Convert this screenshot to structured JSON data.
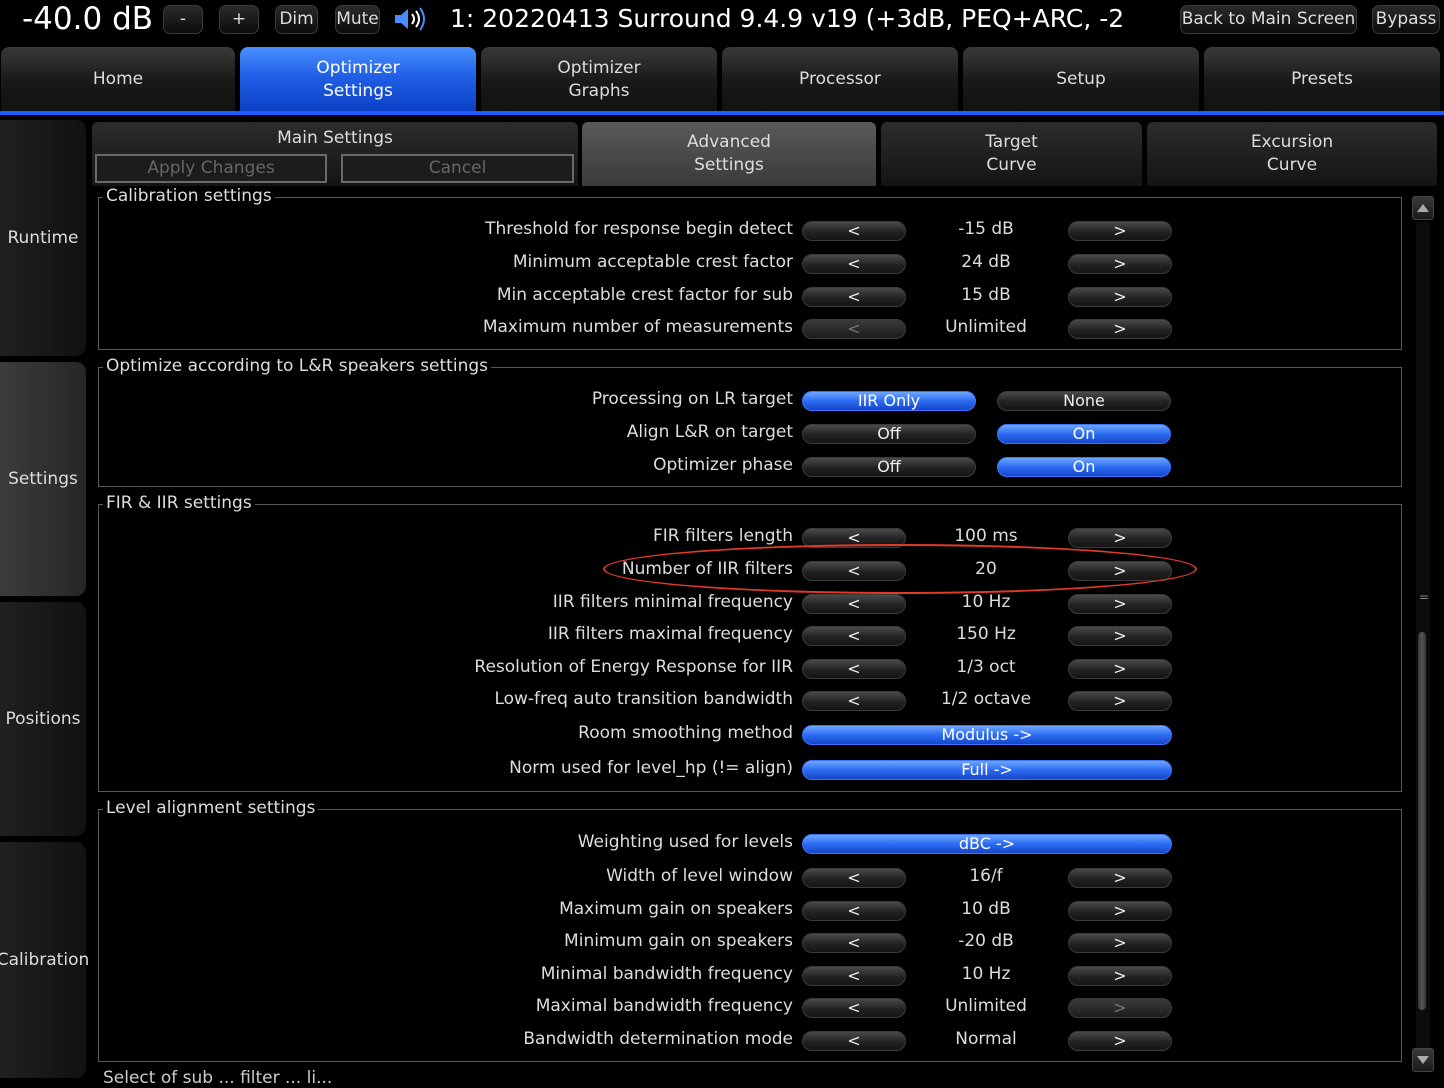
{
  "topbar": {
    "volume": "-40.0 dB",
    "minus_label": "-",
    "plus_label": "+",
    "dim_label": "Dim",
    "mute_label": "Mute",
    "preset_title": "1: 20220413 Surround 9.4.9 v19 (+3dB, PEQ+ARC, -2",
    "back_label": "Back to Main Screen",
    "bypass_label": "Bypass"
  },
  "main_tabs": [
    {
      "label": "Home"
    },
    {
      "label": "Optimizer\nSettings"
    },
    {
      "label": "Optimizer\nGraphs"
    },
    {
      "label": "Processor"
    },
    {
      "label": "Setup"
    },
    {
      "label": "Presets"
    }
  ],
  "side_tabs": [
    {
      "label": "Runtime"
    },
    {
      "label": "Settings"
    },
    {
      "label": "Positions"
    },
    {
      "label": "Calibration"
    }
  ],
  "sub_tabs": {
    "main_settings": "Main Settings",
    "apply_label": "Apply Changes",
    "cancel_label": "Cancel",
    "advanced": "Advanced\nSettings",
    "target": "Target\nCurve",
    "excursion": "Excursion\nCurve"
  },
  "groups": {
    "calibration": {
      "title": "Calibration settings",
      "rows": [
        {
          "label": "Threshold for response begin detect",
          "value": "-15 dB"
        },
        {
          "label": "Minimum acceptable crest factor",
          "value": "24 dB"
        },
        {
          "label": "Min acceptable crest factor for sub",
          "value": "15 dB"
        },
        {
          "label": "Maximum number of measurements",
          "value": "Unlimited"
        }
      ]
    },
    "lr": {
      "title": "Optimize according to L&R speakers settings",
      "rows": [
        {
          "label": "Processing on LR target",
          "opt1": "IIR Only",
          "opt2": "None"
        },
        {
          "label": "Align L&R on target",
          "opt1": "Off",
          "opt2": "On"
        },
        {
          "label": "Optimizer phase",
          "opt1": "Off",
          "opt2": "On"
        }
      ]
    },
    "fir": {
      "title": "FIR & IIR settings",
      "rows": [
        {
          "label": "FIR filters length",
          "value": "100 ms"
        },
        {
          "label": "Number of IIR filters",
          "value": "20"
        },
        {
          "label": "IIR filters minimal frequency",
          "value": "10 Hz"
        },
        {
          "label": "IIR filters maximal frequency",
          "value": "150 Hz"
        },
        {
          "label": "Resolution of Energy Response for IIR",
          "value": "1/3 oct"
        },
        {
          "label": "Low-freq auto transition bandwidth",
          "value": "1/2 octave"
        },
        {
          "label": "Room smoothing method",
          "value": "Modulus ->"
        },
        {
          "label": "Norm used for level_hp (!= align)",
          "value": "Full ->"
        }
      ]
    },
    "level": {
      "title": "Level alignment settings",
      "rows": [
        {
          "label": "Weighting used for levels",
          "value": "dBC ->"
        },
        {
          "label": "Width of level window",
          "value": "16/f"
        },
        {
          "label": "Maximum gain on speakers",
          "value": "10 dB"
        },
        {
          "label": "Minimum gain on speakers",
          "value": "-20 dB"
        },
        {
          "label": "Minimal bandwidth frequency",
          "value": "10 Hz"
        },
        {
          "label": "Maximal bandwidth frequency",
          "value": "Unlimited"
        },
        {
          "label": "Bandwidth determination mode",
          "value": "Normal"
        }
      ]
    }
  },
  "arrows": {
    "left": "<",
    "right": ">"
  },
  "scroll_grip": "=",
  "cutoff_text": "Select of sub ... filter ... li..."
}
